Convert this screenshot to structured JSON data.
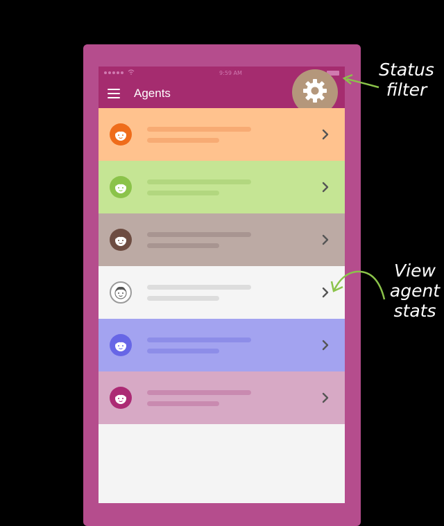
{
  "status_bar": {
    "time": "9:59 AM"
  },
  "app_bar": {
    "title": "Agents",
    "menu_icon": "menu-icon",
    "settings_icon": "gear-icon"
  },
  "agents": [
    {
      "row_color": "#ffc28e",
      "avatar_color": "#ef6c1a",
      "line_color": "#f7ab74"
    },
    {
      "row_color": "#c5e594",
      "avatar_color": "#8bc34a",
      "line_color": "#b2d77f"
    },
    {
      "row_color": "#bcaaa4",
      "avatar_color": "#6d4c41",
      "line_color": "#a89591"
    },
    {
      "row_color": "#f5f5f5",
      "avatar_color": "#ffffff",
      "line_color": "#dddddd"
    },
    {
      "row_color": "#a3a3f0",
      "avatar_color": "#6766e6",
      "line_color": "#8d8de8"
    },
    {
      "row_color": "#d7a9c5",
      "avatar_color": "#ac2a74",
      "line_color": "#c98ab0"
    }
  ],
  "annotations": {
    "status_filter": [
      "Status",
      "filter"
    ],
    "view_stats": [
      "View",
      "agent",
      "stats"
    ]
  },
  "colors": {
    "background": "#000000",
    "device": "#b54d8d",
    "app_bar": "#a52c6f",
    "settings_button": "#b4977b",
    "arrow": "#8bc34a"
  }
}
